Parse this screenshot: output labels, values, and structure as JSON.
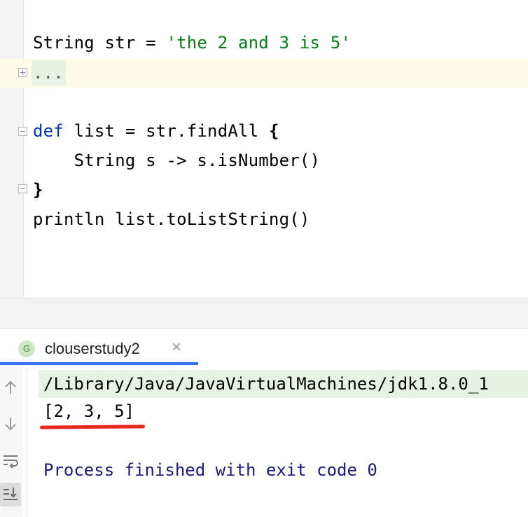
{
  "editor": {
    "line1": {
      "prefix": "String str = ",
      "string_literal": "'the 2 and 3 is 5'"
    },
    "line2_fold": "...",
    "line3": {
      "keyword": "def",
      "rest": " list = str.findAll ",
      "brace": "{"
    },
    "line4": "    String s -> s.isNumber()",
    "line5_brace": "}",
    "line6": "println list.toListString()"
  },
  "console": {
    "tab": {
      "icon_letter": "G",
      "label": "clouserstudy2",
      "close_glyph": "×"
    },
    "command": "/Library/Java/JavaVirtualMachines/jdk1.8.0_1",
    "output": "[2, 3, 5]",
    "exit_message": "Process finished with exit code 0"
  },
  "colors": {
    "keyword": "#0033b3",
    "string": "#067d17",
    "exit_text": "#1a1a80",
    "annotation_underline": "#e8281c",
    "tab_underline": "#3574f0"
  },
  "icons": [
    "fold-expand-icon",
    "fold-collapse-icon",
    "fold-end-icon",
    "groovy-file-icon",
    "close-icon",
    "arrow-up-icon",
    "arrow-down-icon",
    "soft-wrap-icon",
    "scroll-to-end-icon"
  ]
}
